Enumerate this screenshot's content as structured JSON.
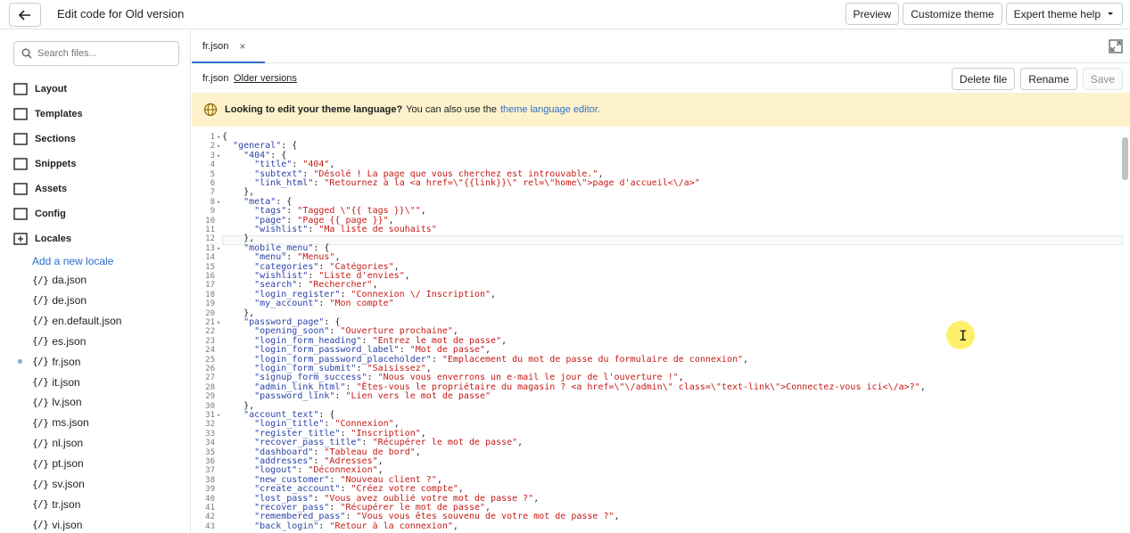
{
  "topbar": {
    "title": "Edit code for Old version",
    "buttons": {
      "preview": "Preview",
      "customize": "Customize theme",
      "help": "Expert theme help"
    }
  },
  "sidebar": {
    "search_placeholder": "Search files...",
    "folders": [
      "Layout",
      "Templates",
      "Sections",
      "Snippets",
      "Assets",
      "Config",
      "Locales"
    ],
    "add_locale": "Add a new locale",
    "file_glyph": "{/}",
    "files": [
      "da.json",
      "de.json",
      "en.default.json",
      "es.json",
      "fr.json",
      "it.json",
      "lv.json",
      "ms.json",
      "nl.json",
      "pt.json",
      "sv.json",
      "tr.json",
      "vi.json"
    ],
    "active_file": "fr.json"
  },
  "editor": {
    "tab_label": "fr.json",
    "tab_close": "×",
    "filename": "fr.json",
    "older_versions": "Older versions",
    "actions": {
      "delete": "Delete file",
      "rename": "Rename",
      "save": "Save"
    },
    "banner": {
      "bold": "Looking to edit your theme language?",
      "text": "You can also use the",
      "link": "theme language editor."
    },
    "lines": [
      "{",
      "  \"general\": {",
      "    \"404\": {",
      "      \"title\": \"404\",",
      "      \"subtext\": \"Désolé ! La page que vous cherchez est introuvable.\",",
      "      \"link_html\": \"Retournez à la <a href=\\\"{{link}}\\\" rel=\\\"home\\\">page d'accueil<\\/a>\"",
      "    },",
      "    \"meta\": {",
      "      \"tags\": \"Tagged \\\"{{ tags }}\\\"\",",
      "      \"page\": \"Page {{ page }}\",",
      "      \"wishlist\": \"Ma liste de souhaits\"",
      "    },",
      "    \"mobile_menu\": {",
      "      \"menu\": \"Menus\",",
      "      \"categories\": \"Catégories\",",
      "      \"wishlist\": \"Liste d'envies\",",
      "      \"search\": \"Rechercher\",",
      "      \"login_register\": \"Connexion \\/ Inscription\",",
      "      \"my_account\": \"Mon compte\"",
      "    },",
      "    \"password_page\": {",
      "      \"opening_soon\": \"Ouverture prochaine\",",
      "      \"login_form_heading\": \"Entrez le mot de passe\",",
      "      \"login_form_password_label\": \"Mot de passe\",",
      "      \"login_form_password_placeholder\": \"Emplacement du mot de passe du formulaire de connexion\",",
      "      \"login_form_submit\": \"Saisissez\",",
      "      \"signup_form_success\": \"Nous vous enverrons un e-mail le jour de l'ouverture !\",",
      "      \"admin_link_html\": \"Êtes-vous le propriétaire du magasin ? <a href=\\\"\\/admin\\\" class=\\\"text-link\\\">Connectez-vous ici<\\/a>?\",",
      "      \"password_link\": \"Lien vers le mot de passe\"",
      "    },",
      "    \"account_text\": {",
      "      \"login_title\": \"Connexion\",",
      "      \"register_title\": \"Inscription\",",
      "      \"recover_pass_title\": \"Récupérer le mot de passe\",",
      "      \"dashboard\": \"Tableau de bord\",",
      "      \"addresses\": \"Adresses\",",
      "      \"logout\": \"Déconnexion\",",
      "      \"new_customer\": \"Nouveau client ?\",",
      "      \"create_account\": \"Créez votre compte\",",
      "      \"lost_pass\": \"Vous avez oublié votre mot de passe ?\",",
      "      \"recover_pass\": \"Récupérer le mot de passe\",",
      "      \"remembered_pass\": \"Vous vous êtes souvenu de votre mot de passe ?\",",
      "      \"back_login\": \"Retour à la connexion\","
    ],
    "line_numbers": [
      "1",
      "2",
      "3",
      "4",
      "5",
      "6",
      "7",
      "8",
      "9",
      "10",
      "11",
      "12",
      "13",
      "14",
      "15",
      "16",
      "17",
      "18",
      "19",
      "20",
      "21",
      "22",
      "23",
      "24",
      "25",
      "26",
      "27",
      "28",
      "29",
      "30",
      "31",
      "32",
      "33",
      "34",
      "35",
      "36",
      "37",
      "38",
      "39",
      "40",
      "41",
      "42",
      "43"
    ],
    "fold_markers": [
      "1",
      "2",
      "3",
      "8",
      "13",
      "21",
      "31"
    ]
  }
}
